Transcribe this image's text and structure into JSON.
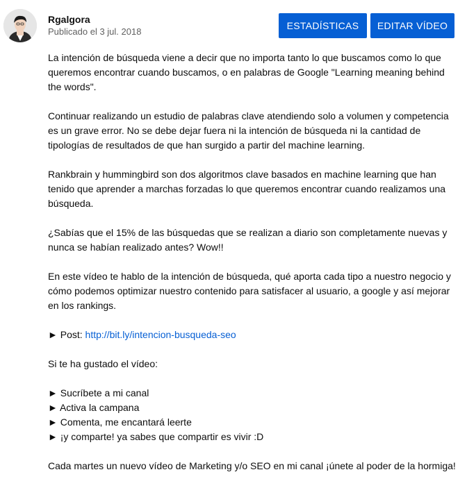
{
  "header": {
    "channel_name": "Rgalgora",
    "publish_date": "Publicado el 3 jul. 2018",
    "stats_button": "ESTADÍSTICAS",
    "edit_button": "EDITAR VÍDEO",
    "accent_color": "#065fd4"
  },
  "description": {
    "p1": "La intención de búsqueda viene a decir que no importa tanto lo que buscamos como lo que\nqueremos encontrar cuando buscamos, o en palabras de Google \"Learning meaning behind\nthe words\".",
    "p2": "Continuar realizando un estudio de palabras clave atendiendo solo a volumen y competencia\nes un grave error. No se debe dejar fuera ni la intención de búsqueda ni  la cantidad de\ntipologías de resultados de que han surgido a partir del machine learning.",
    "p3": "Rankbrain y hummingbird son dos algoritmos clave basados en machine learning que han\ntenido que aprender a marchas forzadas lo que queremos encontrar cuando realizamos una\nbúsqueda.",
    "p4": "¿Sabías que el 15% de las búsquedas que se realizan a diario son completamente nuevas y\nnunca se habían realizado antes? Wow!!",
    "p5": "En este vídeo te hablo de la intención de búsqueda, qué aporta cada tipo a nuestro negocio  y\ncómo podemos optimizar nuestro contenido para satisfacer al usuario, a google y así mejorar\nen los rankings.",
    "post_prefix": "► Post: ",
    "post_link": "http://bit.ly/intencion-busqueda-seo",
    "p6": "Si te ha gustado el vídeo:",
    "bullets": [
      "► Sucríbete a mi canal",
      "► Activa la campana",
      "► Comenta, me encantará leerte",
      "► ¡y comparte! ya sabes que compartir es vivir :D"
    ],
    "p7": "Cada martes un nuevo vídeo de Marketing y/o SEO en mi canal ¡únete al poder de la hormiga!"
  }
}
